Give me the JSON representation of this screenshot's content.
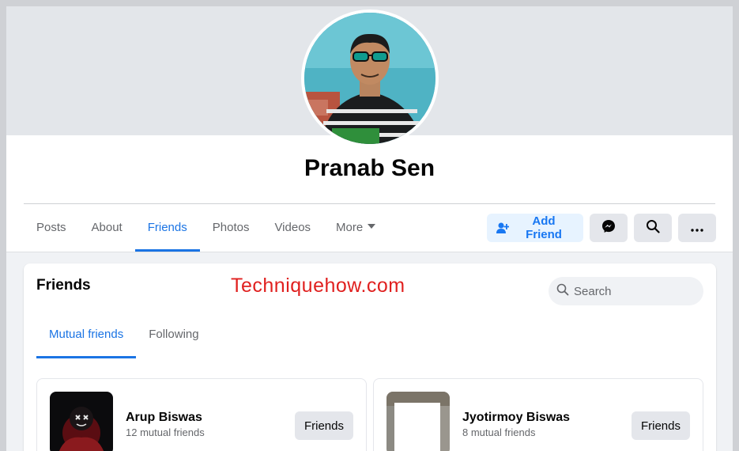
{
  "profile": {
    "name": "Pranab Sen"
  },
  "nav": {
    "tabs": [
      "Posts",
      "About",
      "Friends",
      "Photos",
      "Videos",
      "More"
    ],
    "active": "Friends"
  },
  "actions": {
    "add_friend_label": "Add Friend",
    "icons": [
      "user-plus-icon",
      "messenger-icon",
      "search-icon",
      "more-icon"
    ]
  },
  "friends_section": {
    "title": "Friends",
    "watermark": "Techniquehow.com",
    "search_placeholder": "Search",
    "tabs": [
      "Mutual friends",
      "Following"
    ],
    "active_tab": "Mutual friends",
    "items": [
      {
        "name": "Arup Biswas",
        "mutual": "12 mutual friends",
        "button": "Friends"
      },
      {
        "name": "Jyotirmoy Biswas",
        "mutual": "8 mutual friends",
        "button": "Friends"
      }
    ]
  },
  "colors": {
    "accent": "#1b74e4",
    "watermark": "#e0201f",
    "button_bg": "#e4e6eb",
    "add_friend_bg": "#e7f3ff"
  }
}
